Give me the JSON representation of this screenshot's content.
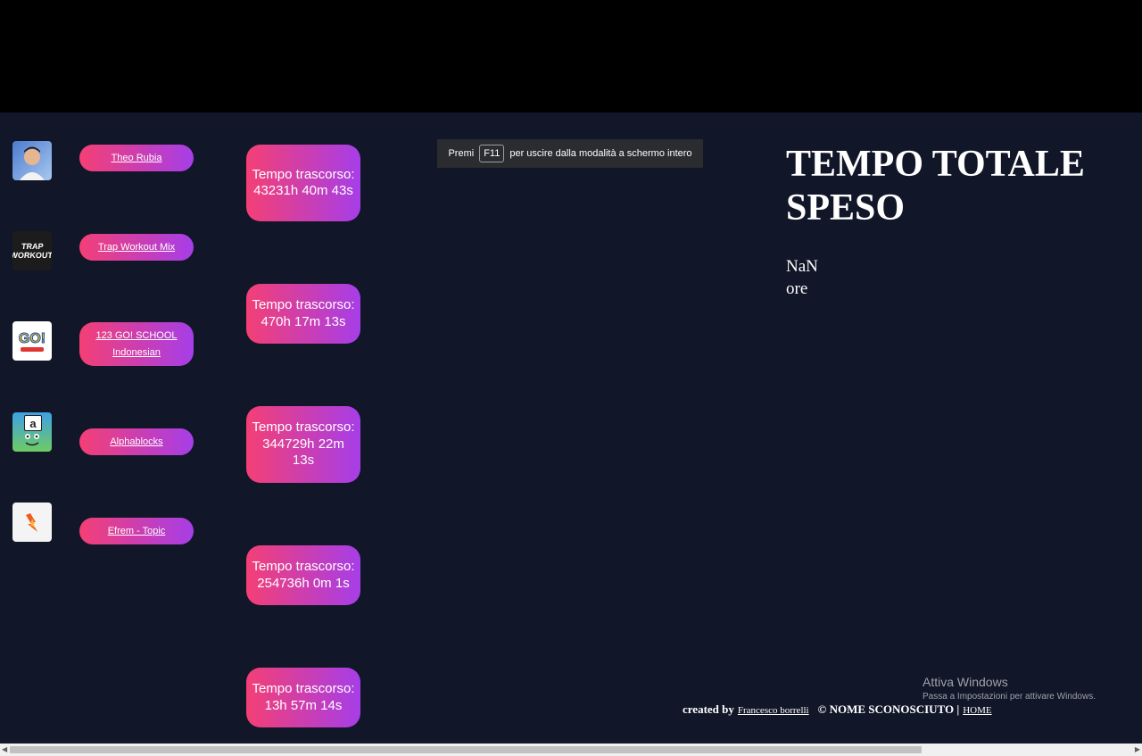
{
  "channels": [
    {
      "name": "Theo Rubia",
      "time": "Tempo trascorso: 43231h 40m 43s"
    },
    {
      "name": "Trap Workout Mix",
      "time": "Tempo trascorso: 470h 17m 13s"
    },
    {
      "name": "123 GO! SCHOOL Indonesian",
      "time": "Tempo trascorso: 344729h 22m 13s"
    },
    {
      "name": "Alphablocks",
      "time": "Tempo trascorso: 254736h 0m 1s"
    },
    {
      "name": "Efrem - Topic",
      "time": "Tempo trascorso: 13h 57m 14s"
    }
  ],
  "avatars": {
    "trap_text_1": "TRAP",
    "trap_text_2": "WORKOUT",
    "go_text": "GO!",
    "alpha_text": "a"
  },
  "fullscreen_notice": {
    "prefix": "Premi",
    "key": "F11",
    "suffix": "per uscire dalla modalità a schermo intero"
  },
  "total": {
    "title": "TEMPO TOTALE SPESO",
    "value": "NaN",
    "unit": "ore"
  },
  "watermark": {
    "line1": "Attiva Windows",
    "line2": "Passa a Impostazioni per attivare Windows."
  },
  "footer": {
    "created_by": "created by",
    "author": "Francesco borrelli",
    "copyright": "© NOME SCONOSCIUTO |",
    "home": "HOME"
  },
  "colors": {
    "pill_start": "#f43f75",
    "pill_end": "#a63ee8",
    "page_bg": "#111628"
  }
}
